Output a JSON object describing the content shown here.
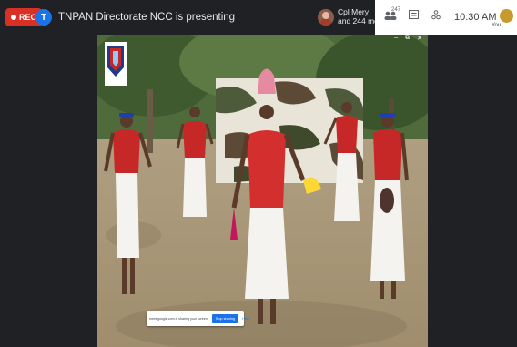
{
  "header": {
    "rec_label": "REC",
    "presenter_initial": "T",
    "presentation_title": "TNPAN Directorate NCC is presenting",
    "participant_name": "Cpl Mery",
    "participant_more": "and 244 more",
    "participants_count": "247",
    "time": "10:30 AM",
    "self_label": "You"
  },
  "video": {
    "window_controls": [
      "‒",
      "⧉",
      "✕"
    ]
  },
  "share_notice": {
    "text": "meet.google.com is sharing your screen.",
    "stop_label": "Stop sharing",
    "hide_label": "Hide"
  },
  "colors": {
    "rec": "#d93025",
    "accent": "#1a73e8",
    "background": "#202124"
  },
  "icons": [
    "rec-dot-icon",
    "people-icon",
    "chat-icon",
    "activities-icon"
  ]
}
